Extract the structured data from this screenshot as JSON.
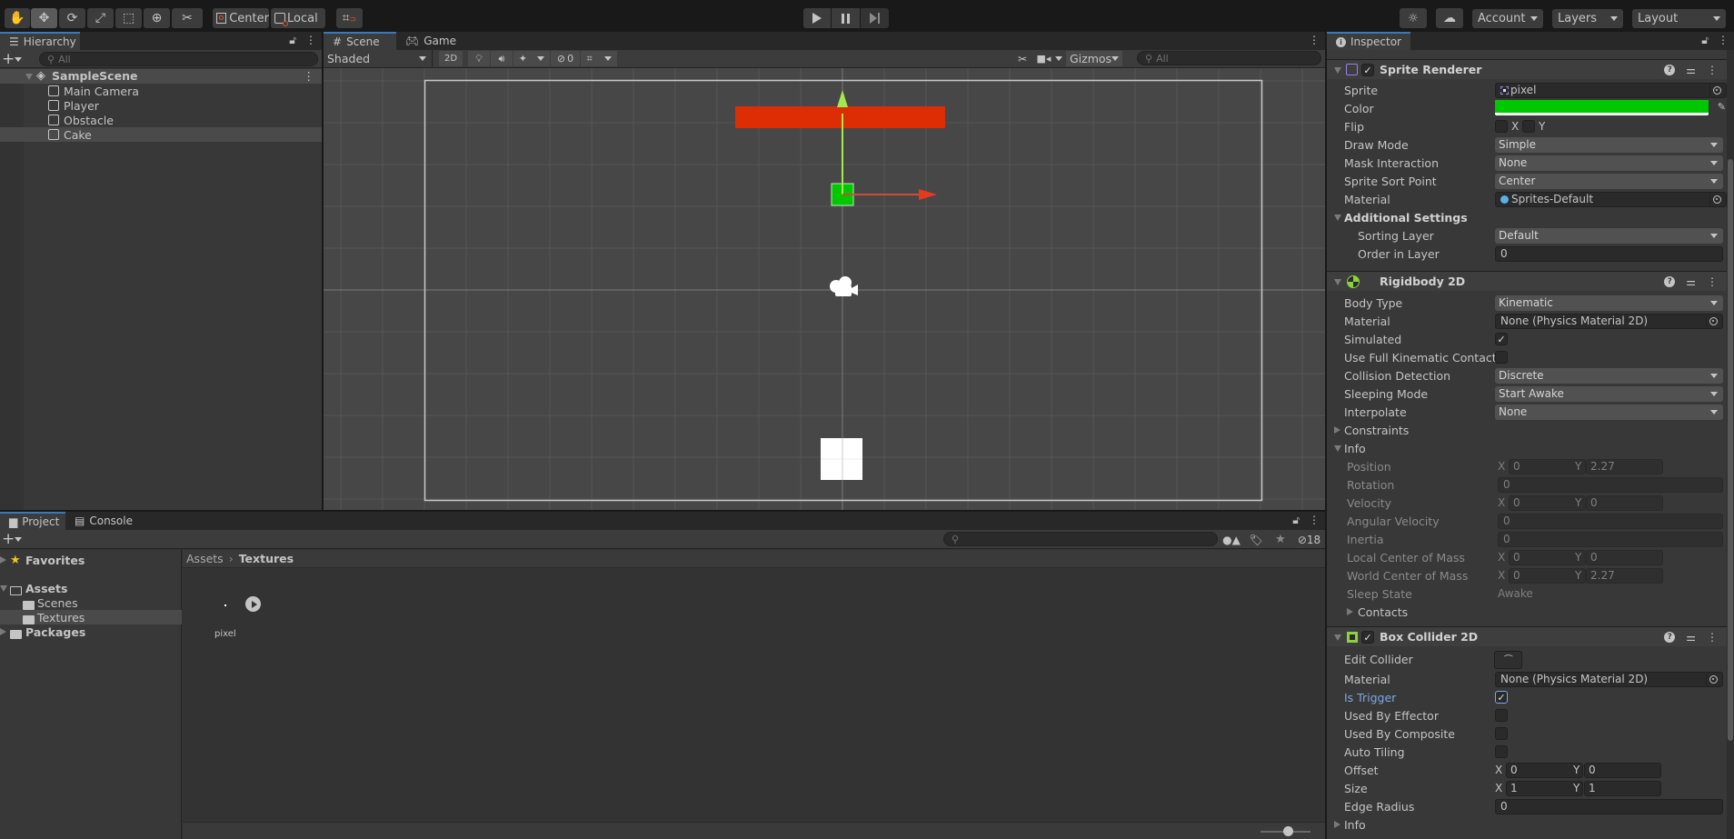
{
  "toolbar": {
    "tools": [
      "hand-tool",
      "move-tool",
      "rotate-tool",
      "scale-tool",
      "rect-tool",
      "transform-tool",
      "custom-tool"
    ],
    "pivot_mode": "Center",
    "pivot_rotation": "Local",
    "play_controls": [
      "play",
      "pause",
      "step"
    ],
    "account_label": "Account",
    "layers_label": "Layers",
    "layout_label": "Layout"
  },
  "hierarchy": {
    "tab_label": "Hierarchy",
    "search_placeholder": "All",
    "scene_name": "SampleScene",
    "items": [
      {
        "label": "Main Camera",
        "selected": false
      },
      {
        "label": "Player",
        "selected": false
      },
      {
        "label": "Obstacle",
        "selected": false
      },
      {
        "label": "Cake",
        "selected": true
      }
    ]
  },
  "scene": {
    "tabs": [
      {
        "label": "Scene",
        "active": true
      },
      {
        "label": "Game",
        "active": false
      }
    ],
    "shading_mode": "Shaded",
    "mode_2d_label": "2D",
    "hidden_count": "0",
    "gizmos_label": "Gizmos",
    "search_placeholder": "All",
    "colors": {
      "background": "#474747",
      "obstacle": "#dd2d05",
      "player": "#00c800",
      "cake": "#ffffff",
      "y_axis_handle": "#a4e84f",
      "x_axis_handle": "#e8391f"
    }
  },
  "project": {
    "tabs": [
      {
        "label": "Project",
        "active": true
      },
      {
        "label": "Console",
        "active": false
      }
    ],
    "tree": [
      {
        "label": "Favorites",
        "bold": true,
        "icon": "star-icon"
      },
      {
        "label": "Assets",
        "bold": true,
        "icon": "folder-open-icon"
      },
      {
        "label": "Scenes",
        "bold": false,
        "icon": "folder-icon"
      },
      {
        "label": "Textures",
        "bold": false,
        "icon": "folder-icon",
        "selected": true
      },
      {
        "label": "Packages",
        "bold": true,
        "icon": "folder-icon"
      }
    ],
    "breadcrumb": [
      "Assets",
      "Textures"
    ],
    "assets": [
      {
        "label": "pixel"
      }
    ],
    "hidden_packages_count": "18"
  },
  "inspector": {
    "tab_label": "Inspector",
    "sprite_renderer": {
      "title": "Sprite Renderer",
      "enabled": true,
      "fields": {
        "sprite_label": "Sprite",
        "sprite_value": "pixel",
        "color_label": "Color",
        "color_value": "#00c800",
        "flip_label": "Flip",
        "flip_x": "X",
        "flip_y": "Y",
        "draw_mode_label": "Draw Mode",
        "draw_mode_value": "Simple",
        "mask_label": "Mask Interaction",
        "mask_value": "None",
        "sort_point_label": "Sprite Sort Point",
        "sort_point_value": "Center",
        "material_label": "Material",
        "material_value": "Sprites-Default",
        "additional_label": "Additional Settings",
        "sorting_layer_label": "Sorting Layer",
        "sorting_layer_value": "Default",
        "order_label": "Order in Layer",
        "order_value": "0"
      }
    },
    "rigidbody": {
      "title": "Rigidbody 2D",
      "fields": {
        "body_type_label": "Body Type",
        "body_type_value": "Kinematic",
        "material_label": "Material",
        "material_value": "None (Physics Material 2D)",
        "simulated_label": "Simulated",
        "simulated": true,
        "full_kinematic_label": "Use Full Kinematic Contacts",
        "full_kinematic": false,
        "collision_label": "Collision Detection",
        "collision_value": "Discrete",
        "sleeping_label": "Sleeping Mode",
        "sleeping_value": "Start Awake",
        "interpolate_label": "Interpolate",
        "interpolate_value": "None",
        "constraints_label": "Constraints",
        "info_label": "Info",
        "position_label": "Position",
        "position_x": "0",
        "position_y": "2.27",
        "rotation_label": "Rotation",
        "rotation_value": "0",
        "velocity_label": "Velocity",
        "velocity_x": "0",
        "velocity_y": "0",
        "angular_label": "Angular Velocity",
        "angular_value": "0",
        "inertia_label": "Inertia",
        "inertia_value": "0",
        "local_com_label": "Local Center of Mass",
        "local_com_x": "0",
        "local_com_y": "0",
        "world_com_label": "World Center of Mass",
        "world_com_x": "0",
        "world_com_y": "2.27",
        "sleep_state_label": "Sleep State",
        "sleep_state_value": "Awake",
        "contacts_label": "Contacts"
      }
    },
    "box_collider": {
      "title": "Box Collider 2D",
      "enabled": true,
      "fields": {
        "edit_label": "Edit Collider",
        "material_label": "Material",
        "material_value": "None (Physics Material 2D)",
        "trigger_label": "Is Trigger",
        "trigger": true,
        "effector_label": "Used By Effector",
        "effector": false,
        "composite_label": "Used By Composite",
        "composite": false,
        "tiling_label": "Auto Tiling",
        "tiling": false,
        "offset_label": "Offset",
        "offset_x": "0",
        "offset_y": "0",
        "size_label": "Size",
        "size_x": "1",
        "size_y": "1",
        "edge_label": "Edge Radius",
        "edge_value": "0",
        "info_label": "Info"
      }
    },
    "axis_x": "X",
    "axis_y": "Y"
  }
}
